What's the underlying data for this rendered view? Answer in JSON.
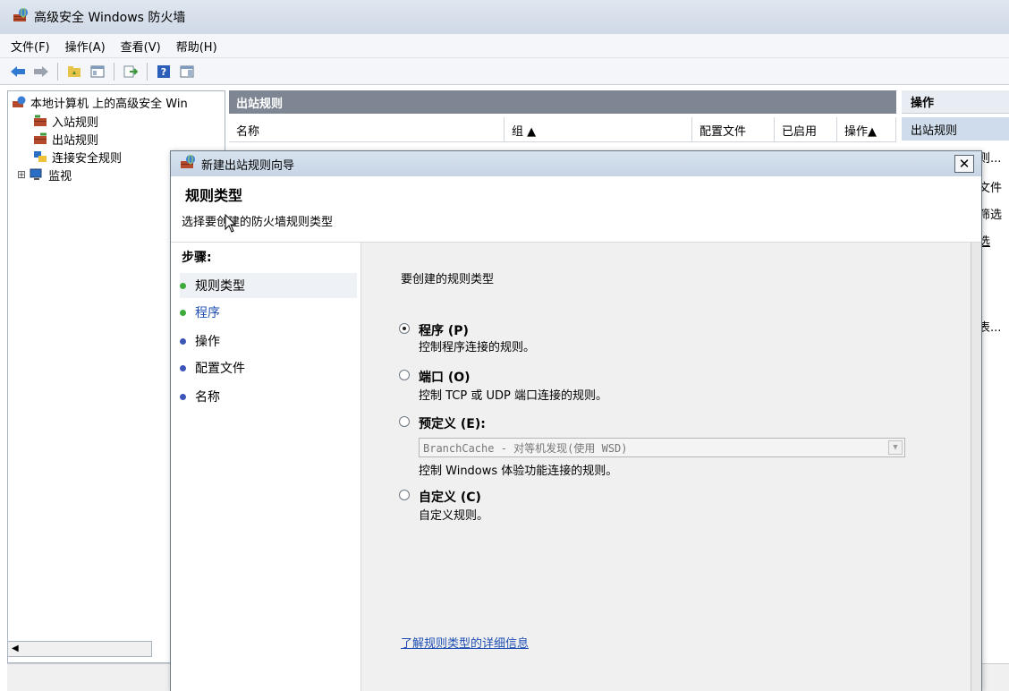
{
  "app": {
    "title": "高级安全 Windows 防火墙",
    "icon": "firewall-icon"
  },
  "menubar": [
    "文件(F)",
    "操作(A)",
    "查看(V)",
    "帮助(H)"
  ],
  "tree": {
    "root": "本地计算机 上的高级安全 Win",
    "items": [
      {
        "label": "入站规则",
        "icon": "inbound-rules-icon"
      },
      {
        "label": "出站规则",
        "icon": "outbound-rules-icon"
      },
      {
        "label": "连接安全规则",
        "icon": "connection-security-icon"
      },
      {
        "label": "监视",
        "icon": "monitor-icon",
        "expander": "⊞"
      }
    ]
  },
  "center": {
    "header": "出站规则",
    "columns": [
      "名称",
      "组 ▲",
      "配置文件",
      "已启用",
      "操作▲"
    ]
  },
  "actions": {
    "header": "操作",
    "selected": "出站规则",
    "peek": [
      "则...",
      "文件",
      "筛选",
      "选",
      "表..."
    ]
  },
  "wizard": {
    "title": "新建出站规则向导",
    "close": "✕",
    "heading": "规则类型",
    "subheading": "选择要创建的防火墙规则类型",
    "steps_label": "步骤:",
    "steps": [
      {
        "label": "规则类型",
        "color": "#3cab3c",
        "active": true
      },
      {
        "label": "程序",
        "color": "#3cab3c",
        "link": true
      },
      {
        "label": "操作",
        "color": "#3b56b7"
      },
      {
        "label": "配置文件",
        "color": "#3b56b7"
      },
      {
        "label": "名称",
        "color": "#3b56b7"
      }
    ],
    "question": "要创建的规则类型",
    "options": [
      {
        "label": "程序 (P)",
        "desc": "控制程序连接的规则。",
        "checked": true
      },
      {
        "label": "端口 (O)",
        "desc": "控制 TCP 或 UDP 端口连接的规则。",
        "checked": false
      },
      {
        "label": "预定义 (E):",
        "desc": "控制 Windows 体验功能连接的规则。",
        "checked": false
      },
      {
        "label": "自定义 (C)",
        "desc": "自定义规则。",
        "checked": false
      }
    ],
    "predefined_value": "BranchCache - 对等机发现(使用 WSD)",
    "learn_more": "了解规则类型的详细信息"
  }
}
